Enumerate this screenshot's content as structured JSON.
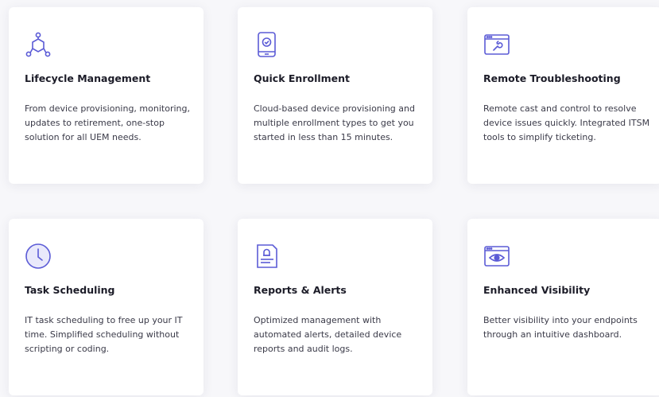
{
  "colors": {
    "icon": "#5b5bd6",
    "card_bg": "#ffffff",
    "page_bg": "#f7f7fa"
  },
  "cards": [
    {
      "icon": "hexagon-nodes-icon",
      "title": "Lifecycle Management",
      "description": "From device provisioning, monitoring, updates to retirement, one-stop solution for all UEM needs."
    },
    {
      "icon": "mobile-check-icon",
      "title": "Quick Enrollment",
      "description": "Cloud-based device provisioning and multiple enrollment types to get you started in less than 15 minutes."
    },
    {
      "icon": "window-wrench-icon",
      "title": "Remote Troubleshooting",
      "description": "Remote cast and control to resolve device issues quickly. Integrated ITSM tools to simplify ticketing."
    },
    {
      "icon": "clock-icon",
      "title": "Task Scheduling",
      "description": "IT task scheduling to free up your IT time. Simplified scheduling without scripting or coding."
    },
    {
      "icon": "report-bell-icon",
      "title": "Reports & Alerts",
      "description": "Optimized management with automated alerts, detailed device reports and audit logs."
    },
    {
      "icon": "window-eye-icon",
      "title": "Enhanced Visibility",
      "description": "Better visibility into your endpoints through an intuitive dashboard."
    }
  ]
}
